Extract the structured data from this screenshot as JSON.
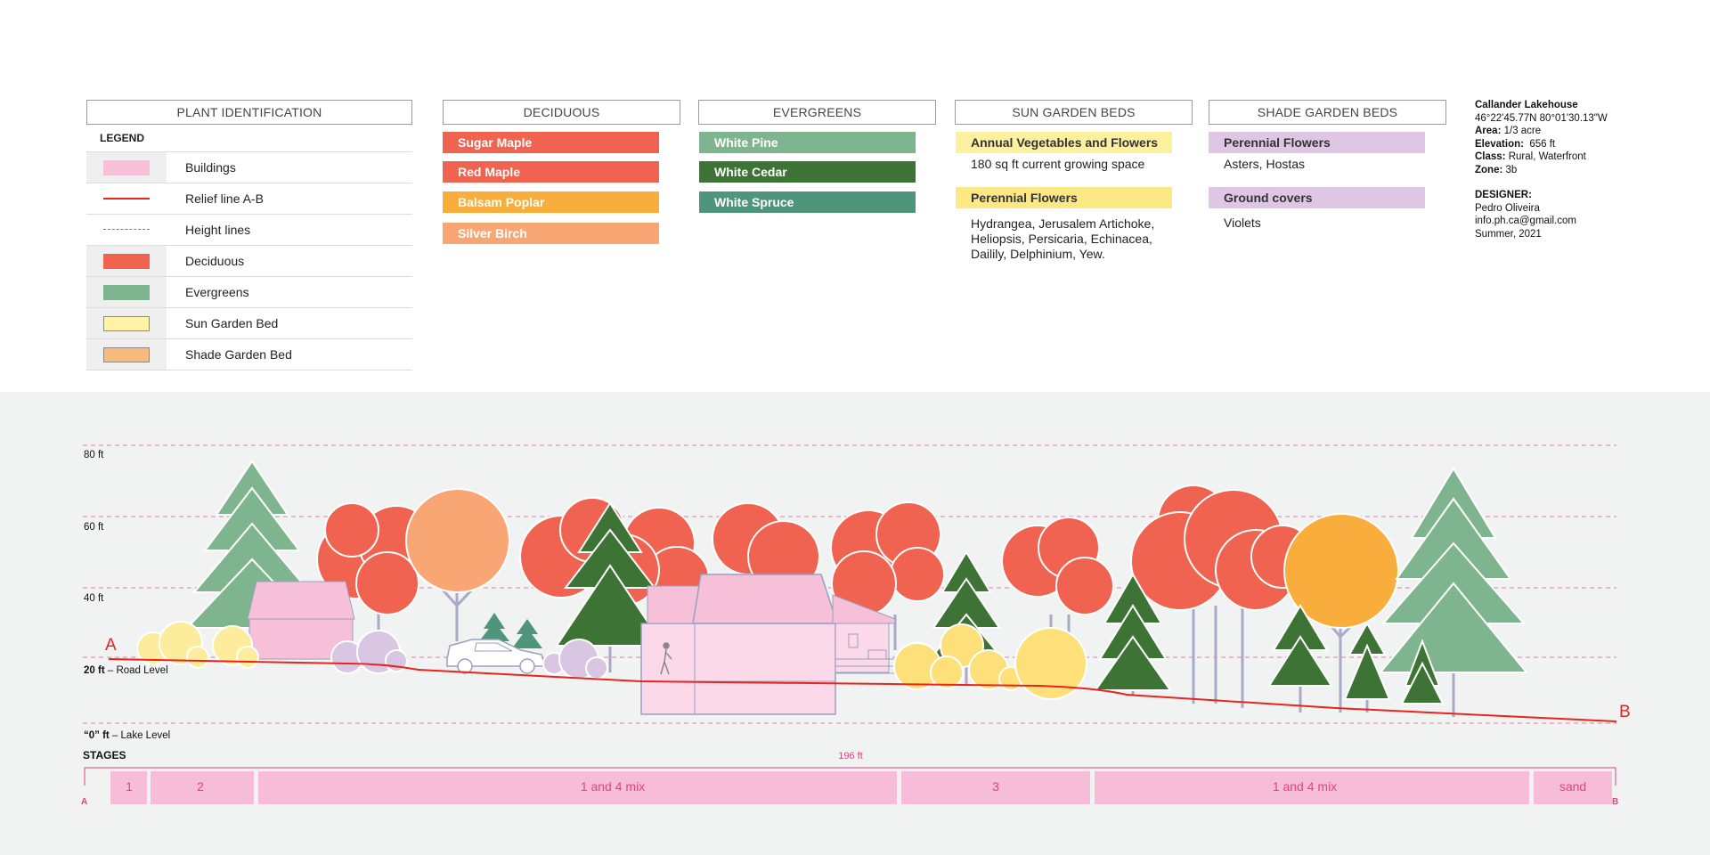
{
  "legend_panel": {
    "title": "PLANT IDENTIFICATION",
    "legend_label": "LEGEND",
    "items": [
      {
        "label": "Buildings",
        "color": "#f7c0d9",
        "kind": "fill"
      },
      {
        "label": "Relief line A-B",
        "color": "#e8241c",
        "kind": "line"
      },
      {
        "label": "Height lines",
        "color": "#e0447f",
        "kind": "dash"
      },
      {
        "label": "Deciduous",
        "color": "#ef6350",
        "kind": "fill"
      },
      {
        "label": "Evergreens",
        "color": "#7fb58e",
        "kind": "fill"
      },
      {
        "label": "Sun Garden Bed",
        "color": "#fff3a6",
        "kind": "fill"
      },
      {
        "label": "Shade Garden Bed",
        "color": "#f8bb7e",
        "kind": "fill"
      }
    ]
  },
  "deciduous": {
    "title": "DECIDUOUS",
    "items": [
      {
        "label": "Sugar Maple",
        "color": "#ef6350"
      },
      {
        "label": "Red Maple",
        "color": "#ef6350"
      },
      {
        "label": "Balsam Poplar",
        "color": "#f8ad3c"
      },
      {
        "label": "Silver Birch",
        "color": "#f8a774"
      }
    ]
  },
  "evergreens": {
    "title": "EVERGREENS",
    "items": [
      {
        "label": "White Pine",
        "color": "#7fb58e"
      },
      {
        "label": "White Cedar",
        "color": "#3d7335"
      },
      {
        "label": "White Spruce",
        "color": "#4f957a"
      }
    ]
  },
  "sun_beds": {
    "title": "SUN GARDEN BEDS",
    "tag1": "Annual Vegetables and Flowers",
    "text1": "180 sq ft current growing space",
    "tag2": "Perennial Flowers",
    "text2_lines": [
      "Hydrangea, Jerusalem Artichoke,",
      "Heliopsis, Persicaria, Echinacea,",
      "Dailily, Delphinium, Yew."
    ],
    "color": "#fdea86"
  },
  "shade_beds": {
    "title": "SHADE GARDEN BEDS",
    "tag1": "Perennial Flowers",
    "text1": "Asters, Hostas",
    "tag2": "Ground covers",
    "text2": "Violets",
    "color": "#dfc6e4"
  },
  "project": {
    "name": "Callander Lakehouse",
    "coords": "46°22'45.77N 80°01'30.13\"W",
    "area_label": "Area:",
    "area": "1/3 acre",
    "elevation_label": "Elevation:",
    "elevation": "656 ft",
    "class_label": "Class:",
    "class_value": "Rural, Waterfront",
    "zone_label": "Zone:",
    "zone": "3b",
    "designer_label": "DESIGNER:",
    "designer": "Pedro Oliveira",
    "email": "info.ph.ca@gmail.com",
    "date": "Summer, 2021"
  },
  "section": {
    "height_labels": [
      "80 ft",
      "60 ft",
      "40 ft"
    ],
    "road_level_value": "20 ft",
    "road_level_text": " – Road Level",
    "lake_level_value": "“0” ft",
    "lake_level_text": " – Lake Level",
    "point_a": "A",
    "point_b": "B",
    "stages_label": "STAGES",
    "length_label": "196 ft",
    "stage_marker_a": "A",
    "stage_marker_b": "B",
    "stages": [
      "1",
      "2",
      "1 and 4 mix",
      "3",
      "1 and 4 mix",
      "sand"
    ],
    "colors": {
      "deciduous_red": "#ef6350",
      "poplar_orange": "#f8ad3c",
      "birch_peach": "#f8a774",
      "pine_green": "#7fb58e",
      "cedar_green": "#3d7335",
      "sun_yellow": "#fde07a",
      "shade_lilac": "#d8c6e2",
      "building_pink": "#f7c0d9",
      "accent_magenta": "#e0447f",
      "relief_red": "#e8241c",
      "stage_pink": "#f7bcd7"
    }
  }
}
